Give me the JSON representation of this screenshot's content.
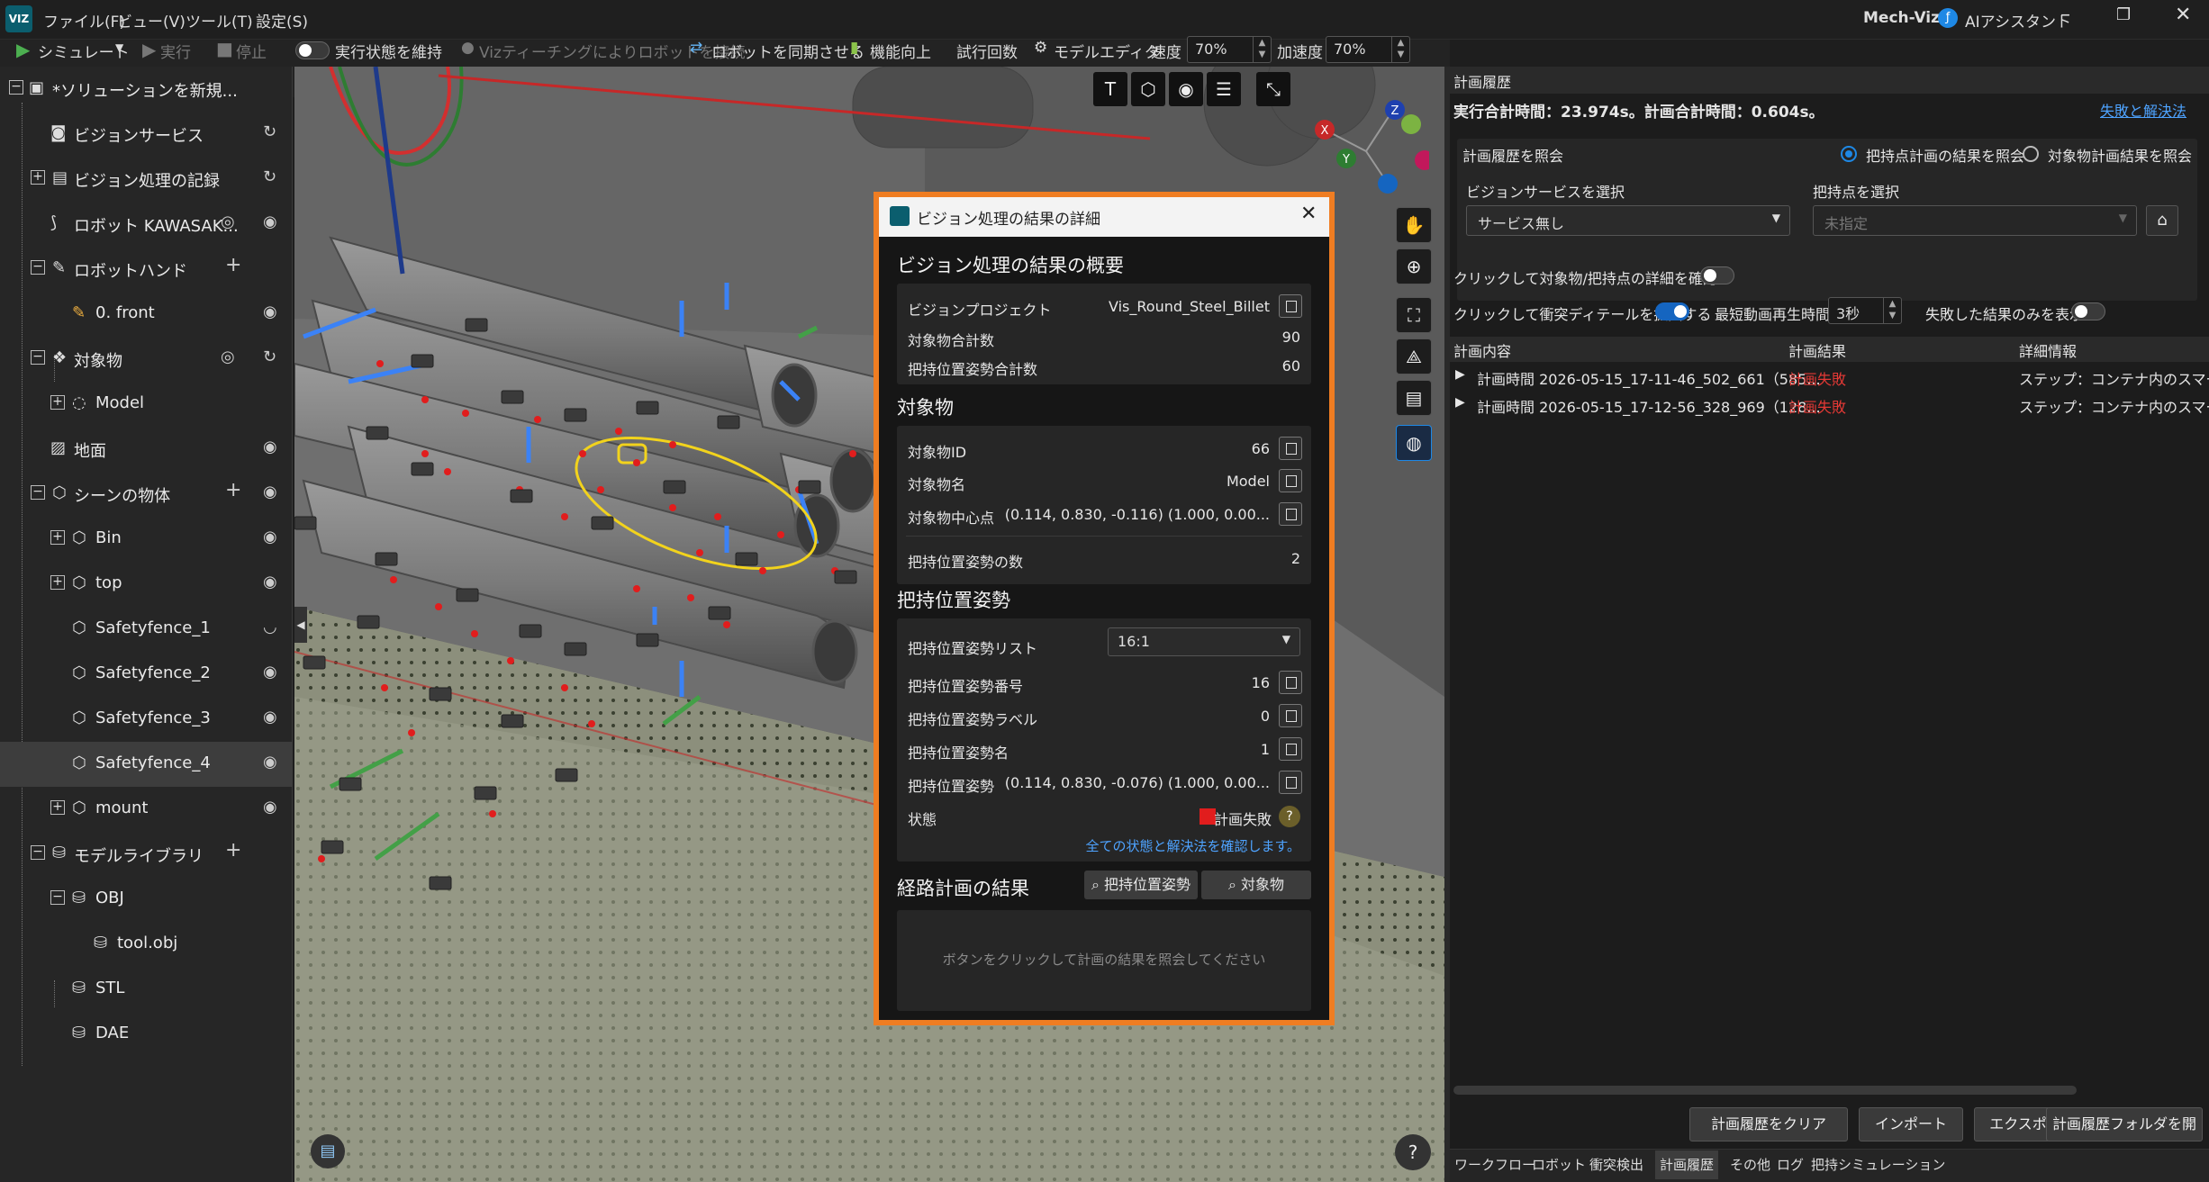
{
  "titlebar": {
    "logo": "VIZ",
    "menus": [
      "ファイル(F)",
      "ビュー(V)",
      "ツール(T)",
      "設定(S)"
    ],
    "app_name": "Mech-Viz",
    "assistant": "AIアシスタント"
  },
  "toolbar": {
    "simulate": "シミュレート",
    "run": "実行",
    "stop": "停止",
    "keep_state": "実行状態を維持",
    "viz_teach": "Vizティーチングによりロボットを接続",
    "sync_robot": "ロボットを同期させる",
    "improve": "機能向上",
    "trials": "試行回数",
    "model_editor": "モデルエディタ",
    "speed_label": "速度",
    "speed_value": "70%",
    "accel_label": "加速度",
    "accel_value": "70%"
  },
  "tree": {
    "items": [
      {
        "label": "*ソリューションを新規...",
        "icon": "folder-icon"
      },
      {
        "label": "ビジョンサービス",
        "icon": "camera-icon"
      },
      {
        "label": "ビジョン処理の記録",
        "icon": "record-icon"
      },
      {
        "label": "ロボット KAWASAK...",
        "icon": "robot-icon"
      },
      {
        "label": "ロボットハンド",
        "icon": "wrench-icon"
      },
      {
        "label": "0. front",
        "icon": "wrench-icon"
      },
      {
        "label": "対象物",
        "icon": "object-icon"
      },
      {
        "label": "Model",
        "icon": "model-icon"
      },
      {
        "label": "地面",
        "icon": "ground-icon"
      },
      {
        "label": "シーンの物体",
        "icon": "scene-icon"
      },
      {
        "label": "Bin",
        "icon": "cube-icon"
      },
      {
        "label": "top",
        "icon": "cube-icon"
      },
      {
        "label": "Safetyfence_1",
        "icon": "cube-icon"
      },
      {
        "label": "Safetyfence_2",
        "icon": "cube-icon"
      },
      {
        "label": "Safetyfence_3",
        "icon": "cube-icon"
      },
      {
        "label": "Safetyfence_4",
        "icon": "cube-icon"
      },
      {
        "label": "mount",
        "icon": "cube-icon"
      },
      {
        "label": "モデルライブラリ",
        "icon": "db-icon"
      },
      {
        "label": "OBJ",
        "icon": "db-icon"
      },
      {
        "label": "tool.obj",
        "icon": "db-icon"
      },
      {
        "label": "STL",
        "icon": "db-icon"
      },
      {
        "label": "DAE",
        "icon": "db-icon"
      }
    ]
  },
  "dialog": {
    "title": "ビジョン処理の結果の詳細",
    "overview": {
      "heading": "ビジョン処理の結果の概要",
      "project_label": "ビジョンプロジェクト",
      "project_value": "Vis_Round_Steel_Billet",
      "obj_total_label": "対象物合計数",
      "obj_total_value": "90",
      "pose_total_label": "把持位置姿勢合計数",
      "pose_total_value": "60"
    },
    "object": {
      "heading": "対象物",
      "id_label": "対象物ID",
      "id_value": "66",
      "name_label": "対象物名",
      "name_value": "Model",
      "center_label": "対象物中心点",
      "center_value": "(0.114, 0.830, -0.116) (1.000, 0.00...",
      "pose_count_label": "把持位置姿勢の数",
      "pose_count_value": "2"
    },
    "pose": {
      "heading": "把持位置姿勢",
      "list_label": "把持位置姿勢リスト",
      "list_value": "16:1",
      "num_label": "把持位置姿勢番号",
      "num_value": "16",
      "tag_label": "把持位置姿勢ラベル",
      "tag_value": "0",
      "name_label": "把持位置姿勢名",
      "name_value": "1",
      "pose_label": "把持位置姿勢",
      "pose_value": "(0.114, 0.830, -0.076) (1.000, 0.00...",
      "state_label": "状態",
      "state_value": "計画失敗",
      "help_link": "全ての状態と解決法を確認します。"
    },
    "path": {
      "heading": "経路計画の結果",
      "btn_pose": "把持位置姿勢",
      "btn_object": "対象物",
      "placeholder": "ボタンをクリックして計画の結果を照会してください"
    }
  },
  "right": {
    "panel_title": "計画履歴",
    "summary": "実行合計時間：23.974s。計画合計時間：0.604s。",
    "failure_link": "失敗と解決法",
    "query_label": "計画履歴を照会",
    "radio1": "把持点計画の結果を照会",
    "radio2": "対象物計画結果を照会",
    "vision_service_label": "ビジョンサービスを選択",
    "vision_service_value": "サービス無し",
    "pick_label": "把持点を選択",
    "pick_placeholder": "未指定",
    "toggle1_label": "クリックして対象物/把持点の詳細を確認",
    "toggle2_label": "クリックして衝突ディテールを拡大する",
    "min_play_label": "最短動画再生時間",
    "min_play_value": "3秒",
    "failed_only_label": "失敗した結果のみを表示",
    "table": {
      "headers": [
        "計画内容",
        "計画結果",
        "詳細情報"
      ],
      "rows": [
        {
          "content": "計画時間 2026-05-15_17-11-46_502_661（585...",
          "result": "計画失敗",
          "detail": "ステップ：コンテナ内のスマート経"
        },
        {
          "content": "計画時間 2026-05-15_17-12-56_328_969（128...",
          "result": "計画失敗",
          "detail": "ステップ：コンテナ内のスマート経"
        }
      ]
    },
    "buttons": [
      "計画履歴をクリア",
      "インポート",
      "エクスポート",
      "計画履歴フォルダを開く"
    ],
    "tabs": [
      "ワークフロー",
      "ロボット",
      "衝突検出",
      "計画履歴",
      "その他",
      "ログ",
      "把持シミュレーション"
    ]
  },
  "viewport": {
    "axes": [
      "X",
      "Y",
      "Z"
    ],
    "help": "?"
  },
  "colors": {
    "accent": "#1e88e5",
    "dialog_border": "#ef7d22",
    "fail": "#e53935",
    "link": "#4ea3ff"
  }
}
